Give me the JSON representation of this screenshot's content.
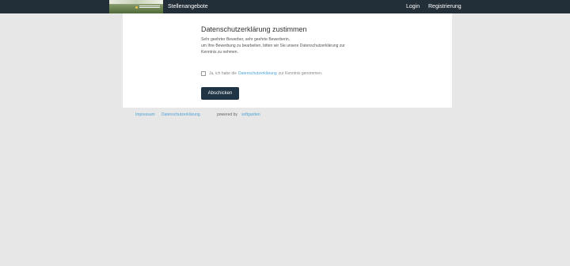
{
  "header": {
    "nav_jobs": "Stellenangebote",
    "login": "Login",
    "register": "Registrierung"
  },
  "main": {
    "title": "Datenschutzerklärung zustimmen",
    "line1": "Sehr geehrter Bewerber, sehr geehrte Bewerberin,",
    "line2": "um Ihre Bewerbung zu bearbeiten, bitten wir Sie unsere Datenschutzerklärung zur",
    "line3": "Kenntnis zu nehmen.",
    "consent_prefix": "Ja, ich habe die",
    "consent_link": "Datenschutzerklärung",
    "consent_suffix": "zur Kenntnis genommen.",
    "submit": "Abschicken"
  },
  "footer": {
    "impressum": "Impressum",
    "privacy": "Datenschutzerklärung",
    "powered_by": "powered by",
    "brand": "softgarden"
  },
  "colors": {
    "topbar": "#232f38",
    "button": "#1f3445",
    "link": "#4ea3d6",
    "background": "#e7e7e7"
  }
}
